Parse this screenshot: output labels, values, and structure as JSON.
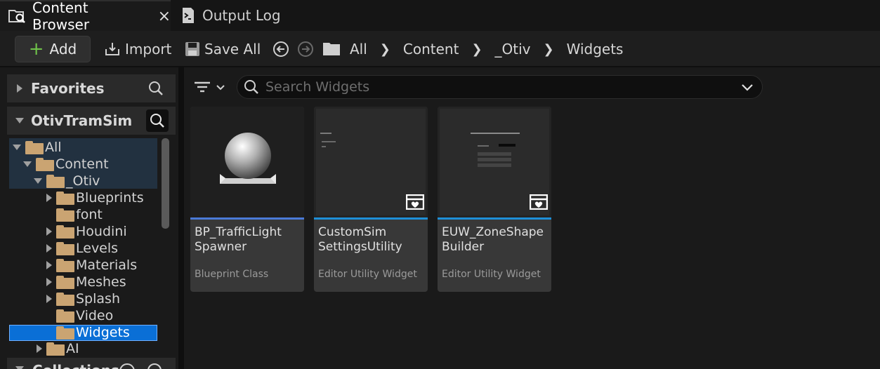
{
  "tabs": {
    "content_browser": "Content Browser",
    "output_log": "Output Log",
    "close_symbol": "×"
  },
  "toolbar": {
    "add": "Add",
    "import": "Import",
    "save_all": "Save All"
  },
  "breadcrumb": [
    "All",
    "Content",
    "_Otiv",
    "Widgets"
  ],
  "sidebar": {
    "favorites": "Favorites",
    "project": "OtivTramSim",
    "collections": "Collections",
    "tree": [
      {
        "label": "All",
        "expanded": true
      },
      {
        "label": "Content",
        "expanded": true
      },
      {
        "label": "_Otiv",
        "expanded": true
      },
      {
        "label": "Blueprints",
        "has_children": true
      },
      {
        "label": "font",
        "has_children": false
      },
      {
        "label": "Houdini",
        "has_children": true
      },
      {
        "label": "Levels",
        "has_children": true
      },
      {
        "label": "Materials",
        "has_children": true
      },
      {
        "label": "Meshes",
        "has_children": true
      },
      {
        "label": "Splash",
        "has_children": true
      },
      {
        "label": "Video",
        "has_children": false
      },
      {
        "label": "Widgets",
        "has_children": false,
        "selected": true
      },
      {
        "label": "AI",
        "has_children": true
      }
    ]
  },
  "search": {
    "placeholder": "Search Widgets"
  },
  "assets": [
    {
      "name_line1": "BP_TrafficLight",
      "name_line2": "Spawner",
      "type": "Blueprint Class",
      "color": "#4a7ad8"
    },
    {
      "name_line1": "CustomSim",
      "name_line2": "SettingsUtility",
      "type": "Editor Utility Widget",
      "color": "#1e8fd8"
    },
    {
      "name_line1": "EUW_ZoneShape",
      "name_line2": "Builder",
      "type": "Editor Utility Widget",
      "color": "#1e8fd8"
    }
  ],
  "colors": {
    "accent_selected": "#0a6fd6",
    "folder": "#caa472",
    "add_plus": "#6fc24a"
  }
}
